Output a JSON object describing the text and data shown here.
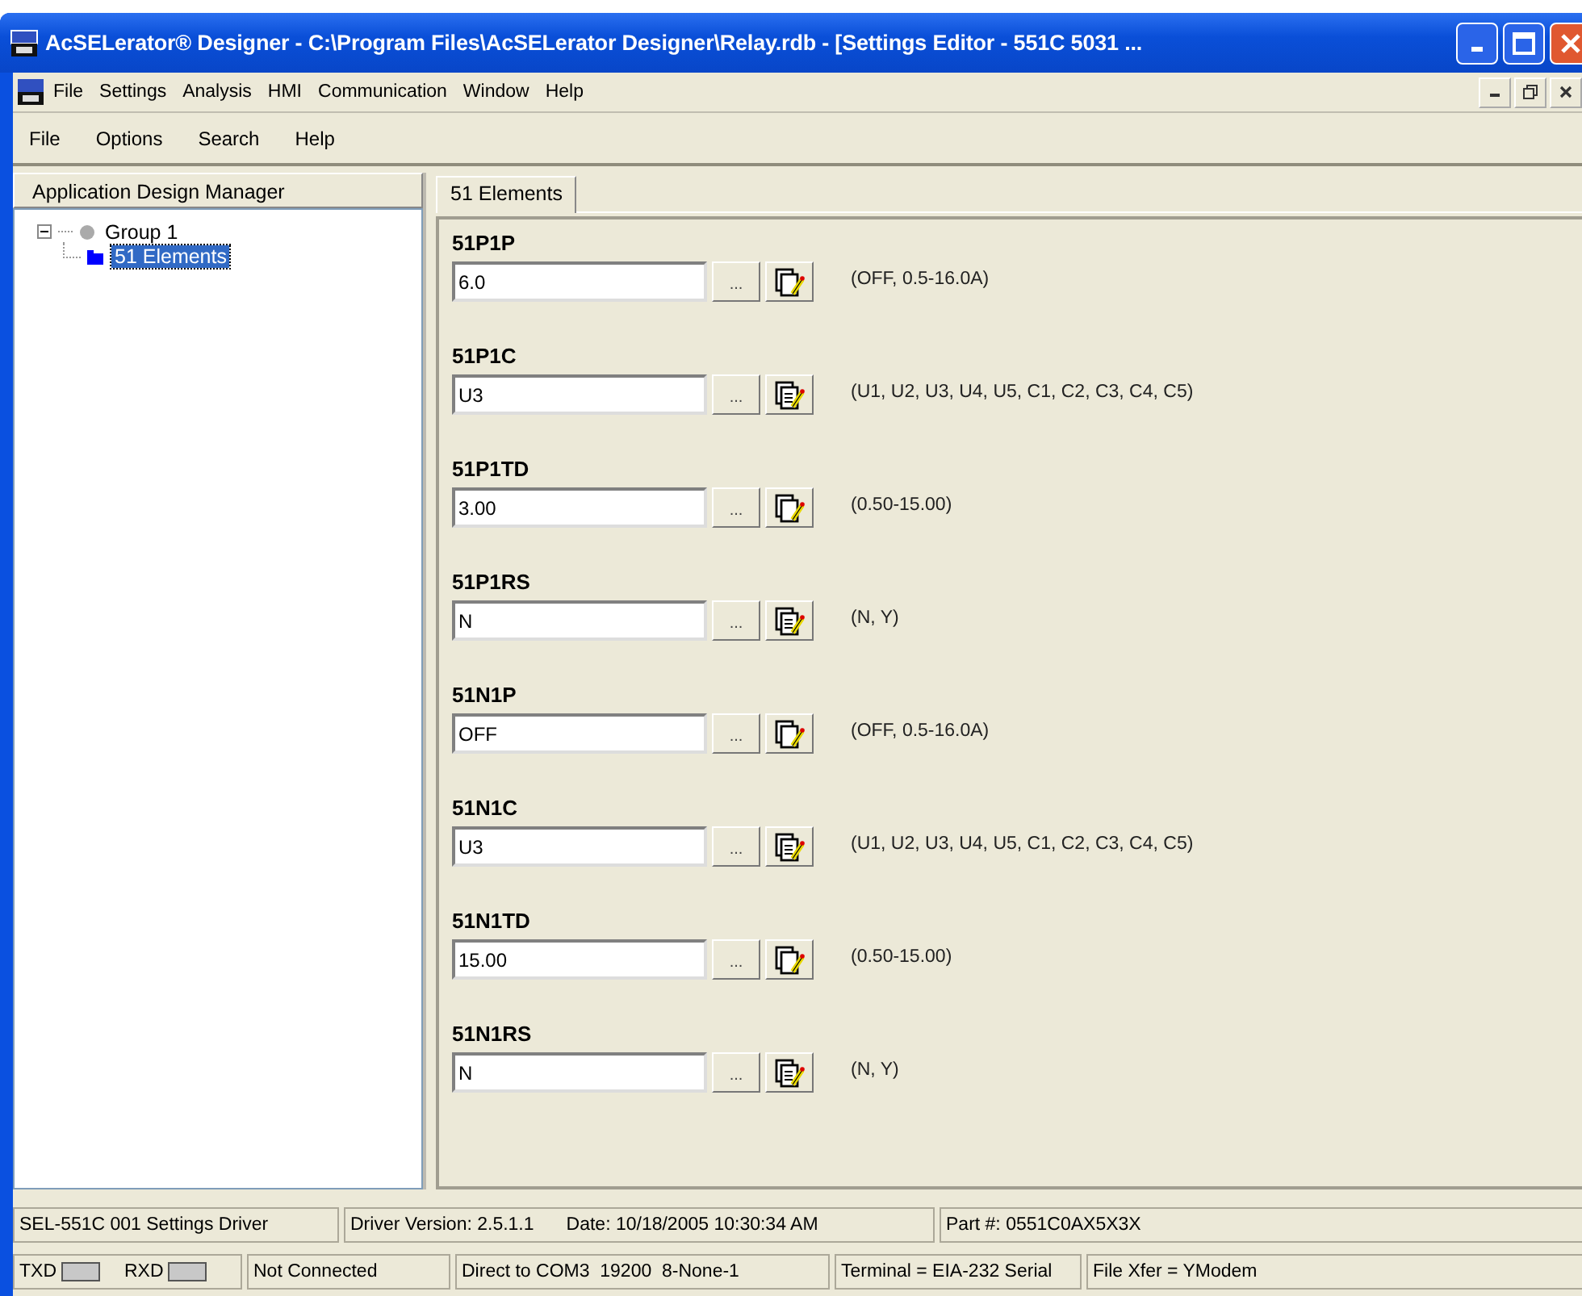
{
  "window": {
    "title": "AcSELerator® Designer - C:\\Program Files\\AcSELerator Designer\\Relay.rdb - [Settings Editor - 551C 5031 ..."
  },
  "menu_bar": [
    "File",
    "Settings",
    "Analysis",
    "HMI",
    "Communication",
    "Window",
    "Help"
  ],
  "toolbar_menu": [
    "File",
    "Options",
    "Search",
    "Help"
  ],
  "sidebar": {
    "title": "Application Design Manager",
    "tree": [
      {
        "label": "Group 1",
        "expanded": true,
        "selected": false,
        "children": [
          {
            "label": "51 Elements",
            "selected": true
          }
        ]
      }
    ]
  },
  "tabs": [
    {
      "label": "51 Elements",
      "selected": true
    }
  ],
  "settings": [
    {
      "name": "51P1P",
      "value": "6.0",
      "kind": "range",
      "range": "(OFF, 0.5-16.0A)"
    },
    {
      "name": "51P1C",
      "value": "U3",
      "kind": "list",
      "range": "(U1, U2, U3, U4, U5, C1, C2, C3, C4, C5)"
    },
    {
      "name": "51P1TD",
      "value": "3.00",
      "kind": "range",
      "range": "(0.50-15.00)"
    },
    {
      "name": "51P1RS",
      "value": "N",
      "kind": "list",
      "range": "(N, Y)"
    },
    {
      "name": "51N1P",
      "value": "OFF",
      "kind": "range",
      "range": "(OFF, 0.5-16.0A)"
    },
    {
      "name": "51N1C",
      "value": "U3",
      "kind": "list",
      "range": "(U1, U2, U3, U4, U5, C1, C2, C3, C4, C5)"
    },
    {
      "name": "51N1TD",
      "value": "15.00",
      "kind": "range",
      "range": "(0.50-15.00)"
    },
    {
      "name": "51N1RS",
      "value": "N",
      "kind": "list",
      "range": "(N, Y)"
    }
  ],
  "browse_button": "...",
  "status_bar": {
    "row_1": [
      "SEL-551C 001 Settings Driver",
      "Driver Version: 2.5.1.1",
      "Date: 10/18/2005 10:30:34 AM",
      "Part #: 0551C0AX5X3X"
    ],
    "row_2": {
      "txd": "TXD",
      "rxd": "RXD",
      "cells": [
        "Not Connected",
        "Direct to COM3  19200  8-None-1",
        "Terminal = EIA-232 Serial",
        "File Xfer = YModem"
      ]
    }
  }
}
